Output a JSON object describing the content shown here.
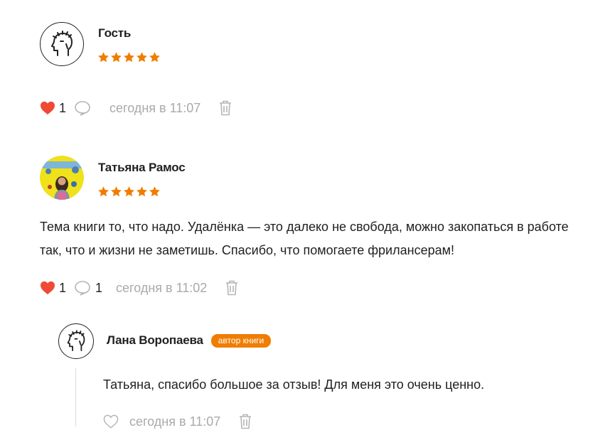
{
  "comments": [
    {
      "author": "Гость",
      "avatar_icon": "guest-laurel-head-icon",
      "rating": 5,
      "text": "",
      "likes": "1",
      "time": "сегодня в 11:07"
    },
    {
      "author": "Татьяна Рамос",
      "avatar_icon": "user-photo",
      "rating": 5,
      "text_line1": "Тема книги то, что надо. Удалёнка — это далеко не свобода, можно закопаться в работе",
      "text_line2": "так, что и жизни не заметишь. Спасибо, что помогаете фрилансерам!",
      "likes": "1",
      "replies": "1",
      "time": "сегодня в 11:02"
    }
  ],
  "reply": {
    "author": "Лана Воропаева",
    "badge": "автор книги",
    "avatar_icon": "guest-laurel-head-icon",
    "text": "Татьяна, спасибо большое за отзыв! Для меня это очень ценно.",
    "time": "сегодня в 11:07"
  },
  "colors": {
    "accent": "#f07d00",
    "star": "#f07d00",
    "heart_active": "#ef4a36",
    "muted": "#aaaaaa"
  }
}
